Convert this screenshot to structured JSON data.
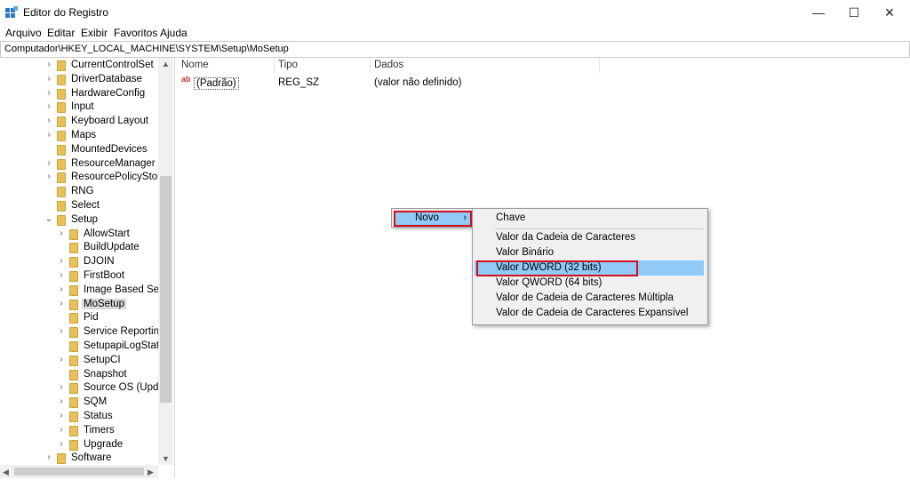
{
  "window": {
    "title": "Editor do Registro",
    "controls": {
      "minimize": "—",
      "maximize": "☐",
      "close": "✕"
    }
  },
  "menu": [
    "Arquivo",
    "Editar",
    "Exibir",
    "Favoritos",
    "Ajuda"
  ],
  "address": "Computador\\HKEY_LOCAL_MACHINE\\SYSTEM\\Setup\\MoSetup",
  "tree": {
    "items": [
      {
        "label": "CurrentControlSet",
        "level": 1,
        "expander": "›"
      },
      {
        "label": "DriverDatabase",
        "level": 1,
        "expander": "›"
      },
      {
        "label": "HardwareConfig",
        "level": 1,
        "expander": "›"
      },
      {
        "label": "Input",
        "level": 1,
        "expander": "›"
      },
      {
        "label": "Keyboard Layout",
        "level": 1,
        "expander": "›"
      },
      {
        "label": "Maps",
        "level": 1,
        "expander": "›"
      },
      {
        "label": "MountedDevices",
        "level": 1,
        "expander": ""
      },
      {
        "label": "ResourceManager",
        "level": 1,
        "expander": "›"
      },
      {
        "label": "ResourcePolicyStore",
        "level": 1,
        "expander": "›"
      },
      {
        "label": "RNG",
        "level": 1,
        "expander": ""
      },
      {
        "label": "Select",
        "level": 1,
        "expander": ""
      },
      {
        "label": "Setup",
        "level": 1,
        "expander": "⌄"
      },
      {
        "label": "AllowStart",
        "level": 2,
        "expander": "›"
      },
      {
        "label": "BuildUpdate",
        "level": 2,
        "expander": ""
      },
      {
        "label": "DJOIN",
        "level": 2,
        "expander": "›"
      },
      {
        "label": "FirstBoot",
        "level": 2,
        "expander": "›"
      },
      {
        "label": "Image Based Setu",
        "level": 2,
        "expander": "›"
      },
      {
        "label": "MoSetup",
        "level": 2,
        "expander": "›",
        "selected": true
      },
      {
        "label": "Pid",
        "level": 2,
        "expander": ""
      },
      {
        "label": "Service Reporting",
        "level": 2,
        "expander": "›"
      },
      {
        "label": "SetupapiLogStatu",
        "level": 2,
        "expander": ""
      },
      {
        "label": "SetupCI",
        "level": 2,
        "expander": "›"
      },
      {
        "label": "Snapshot",
        "level": 2,
        "expander": ""
      },
      {
        "label": "Source OS (Updat",
        "level": 2,
        "expander": "›"
      },
      {
        "label": "SQM",
        "level": 2,
        "expander": "›"
      },
      {
        "label": "Status",
        "level": 2,
        "expander": "›"
      },
      {
        "label": "Timers",
        "level": 2,
        "expander": "›"
      },
      {
        "label": "Upgrade",
        "level": 2,
        "expander": "›"
      },
      {
        "label": "Software",
        "level": 1,
        "expander": "›"
      }
    ]
  },
  "list": {
    "columns": [
      "Nome",
      "Tipo",
      "Dados"
    ],
    "rows": [
      {
        "name": "(Padrão)",
        "type": "REG_SZ",
        "data": "(valor não definido)",
        "icon": "ab-string-icon"
      }
    ]
  },
  "context_menu": {
    "parent_item": "Novo",
    "parent_arrow": "›",
    "submenu": [
      "Chave",
      "Valor da Cadeia de Caracteres",
      "Valor Binário",
      "Valor DWORD (32 bits)",
      "Valor QWORD (64 bits)",
      "Valor de Cadeia de Caracteres Múltipla",
      "Valor de Cadeia de Caracteres Expansível"
    ],
    "highlighted": "Valor DWORD (32 bits)"
  },
  "colors": {
    "highlight": "#91c9f7",
    "annotation": "#d0101d",
    "folder": "#e8c15a"
  }
}
